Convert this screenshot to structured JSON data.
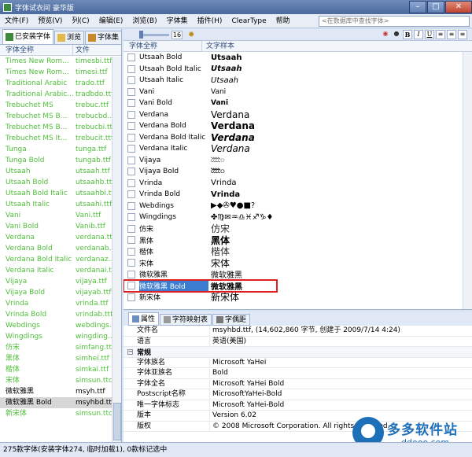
{
  "window": {
    "title": "字体试衣间 豪华版"
  },
  "menu": {
    "items": [
      "文件(F)",
      "预览(V)",
      "列(C)",
      "编辑(E)",
      "浏览(B)",
      "字体集",
      "插件(H)",
      "ClearType",
      "帮助"
    ],
    "search_placeholder": "<在数据库中查找字体>"
  },
  "left_tabs": [
    "已安装字体",
    "浏览",
    "字体集"
  ],
  "left_columns": {
    "name": "字体全称",
    "file": "文件"
  },
  "left_rows": [
    {
      "name": "Times New Rom...",
      "file": "timesbi.ttf",
      "style": "green"
    },
    {
      "name": "Times New Rom...",
      "file": "timesi.ttf",
      "style": "green"
    },
    {
      "name": "Traditional Arabic",
      "file": "trado.ttf",
      "style": "green"
    },
    {
      "name": "Traditional Arabic...",
      "file": "tradbdo.ttf",
      "style": "green"
    },
    {
      "name": "Trebuchet MS",
      "file": "trebuc.ttf",
      "style": "green"
    },
    {
      "name": "Trebuchet MS B...",
      "file": "trebucbd....",
      "style": "green"
    },
    {
      "name": "Trebuchet MS B...",
      "file": "trebucbi.ttf",
      "style": "green"
    },
    {
      "name": "Trebuchet MS It...",
      "file": "trebucit.ttf",
      "style": "green"
    },
    {
      "name": "Tunga",
      "file": "tunga.ttf",
      "style": "green"
    },
    {
      "name": "Tunga Bold",
      "file": "tungab.ttf",
      "style": "green"
    },
    {
      "name": "Utsaah",
      "file": "utsaah.ttf",
      "style": "green"
    },
    {
      "name": "Utsaah Bold",
      "file": "utsaahb.ttf",
      "style": "green"
    },
    {
      "name": "Utsaah Bold Italic",
      "file": "utsaahbi.ttf",
      "style": "green"
    },
    {
      "name": "Utsaah Italic",
      "file": "utsaahi.ttf",
      "style": "green"
    },
    {
      "name": "Vani",
      "file": "Vani.ttf",
      "style": "green"
    },
    {
      "name": "Vani Bold",
      "file": "Vanib.ttf",
      "style": "green"
    },
    {
      "name": "Verdana",
      "file": "verdana.ttf",
      "style": "green"
    },
    {
      "name": "Verdana Bold",
      "file": "verdanab...",
      "style": "green"
    },
    {
      "name": "Verdana Bold Italic",
      "file": "verdanaz...",
      "style": "green"
    },
    {
      "name": "Verdana Italic",
      "file": "verdanai.ttf",
      "style": "green"
    },
    {
      "name": "Vijaya",
      "file": "vijaya.ttf",
      "style": "green"
    },
    {
      "name": "Vijaya Bold",
      "file": "vijayab.ttf",
      "style": "green"
    },
    {
      "name": "Vrinda",
      "file": "vrinda.ttf",
      "style": "green"
    },
    {
      "name": "Vrinda Bold",
      "file": "vrindab.ttf",
      "style": "green"
    },
    {
      "name": "Webdings",
      "file": "webdings...",
      "style": "green"
    },
    {
      "name": "Wingdings",
      "file": "wingding...",
      "style": "green"
    },
    {
      "name": "仿宋",
      "file": "simfang.ttf",
      "style": "green"
    },
    {
      "name": "黑体",
      "file": "simhei.ttf",
      "style": "green"
    },
    {
      "name": "楷体",
      "file": "simkai.ttf",
      "style": "green"
    },
    {
      "name": "宋体",
      "file": "simsun.ttc",
      "style": "green"
    },
    {
      "name": "微软雅黑",
      "file": "msyh.ttf",
      "style": "black"
    },
    {
      "name": "微软雅黑 Bold",
      "file": "msyhbd.ttf",
      "style": "sel"
    },
    {
      "name": "新宋体",
      "file": "simsun.ttc",
      "style": "green"
    }
  ],
  "toolbar": {
    "size": "16",
    "bold": "B",
    "italic": "I",
    "underline": "U"
  },
  "font_columns": {
    "name": "字体全称",
    "sample": "文字样本"
  },
  "font_rows": [
    {
      "name": "Utsaah Bold",
      "sample": "Utsaah",
      "css": "font-weight:bold;font-size:10px"
    },
    {
      "name": "Utsaah Bold Italic",
      "sample": "Utsaah",
      "css": "font-weight:bold;font-style:italic;font-size:10px"
    },
    {
      "name": "Utsaah Italic",
      "sample": "Utsaah",
      "css": "font-style:italic;font-size:10px"
    },
    {
      "name": "Vani",
      "sample": "Vani",
      "css": "font-size:9px"
    },
    {
      "name": "Vani Bold",
      "sample": "Vani",
      "css": "font-weight:bold;font-size:9px"
    },
    {
      "name": "Verdana",
      "sample": "Verdana",
      "css": "font-size:12px"
    },
    {
      "name": "Verdana Bold",
      "sample": "Verdana",
      "css": "font-weight:bold;font-size:12px"
    },
    {
      "name": "Verdana Bold Italic",
      "sample": "Verdana",
      "css": "font-weight:bold;font-style:italic;font-size:12px"
    },
    {
      "name": "Verdana Italic",
      "sample": "Verdana",
      "css": "font-style:italic;font-size:12px"
    },
    {
      "name": "Vijaya",
      "sample": "ৈৈৈৈ",
      "css": "font-size:7px"
    },
    {
      "name": "Vijaya Bold",
      "sample": "ৈৈৈৈ",
      "css": "font-weight:bold;font-size:7px"
    },
    {
      "name": "Vrinda",
      "sample": "Vrinda",
      "css": "font-size:10px"
    },
    {
      "name": "Vrinda Bold",
      "sample": "Vrinda",
      "css": "font-weight:bold;font-size:10px"
    },
    {
      "name": "Webdings",
      "sample": "▶◆✇♥●■?",
      "css": "font-size:10px"
    },
    {
      "name": "Wingdings",
      "sample": "✤♍✉♒♎♓♐♑♦",
      "css": "font-size:10px"
    },
    {
      "name": "仿宋",
      "sample": "仿宋",
      "css": "font-size:12px;color:#333"
    },
    {
      "name": "黑体",
      "sample": "黑体",
      "css": "font-size:12px;font-weight:bold"
    },
    {
      "name": "楷体",
      "sample": "楷体",
      "css": "font-size:12px;color:#333"
    },
    {
      "name": "宋体",
      "sample": "宋体",
      "css": "font-size:12px"
    },
    {
      "name": "微软雅黑",
      "sample": "微软雅黑",
      "css": "font-size:10px"
    },
    {
      "name": "微软雅黑 Bold",
      "sample": "微软雅黑",
      "css": "font-size:10px;font-weight:bold",
      "selected": true
    },
    {
      "name": "新宋体",
      "sample": "新宋体",
      "css": "font-size:12px"
    }
  ],
  "bottom_tabs": [
    "属性",
    "字符映射表",
    "字偶距"
  ],
  "properties": {
    "file_label": "文件名",
    "file_value": "msyhbd.ttf, (14,602,860 字节, 创建于 2009/7/14 4:24)",
    "lang_label": "语言",
    "lang_value": "英语(美国)",
    "section": "常规",
    "rows": [
      {
        "k": "字体族名",
        "v": "Microsoft YaHei"
      },
      {
        "k": "字体亚族名",
        "v": "Bold"
      },
      {
        "k": "字体全名",
        "v": "Microsoft YaHei Bold"
      },
      {
        "k": "Postscript名称",
        "v": "MicrosoftYaHei-Bold"
      },
      {
        "k": "唯一字体标志",
        "v": "Microsoft YaHei-Bold"
      },
      {
        "k": "版本",
        "v": "Version 6.02"
      },
      {
        "k": "版权",
        "v": "© 2008 Microsoft Corporation. All rights reserved."
      }
    ]
  },
  "watermark": {
    "title": "多多软件站",
    "url": "ddooo.com"
  },
  "status": "275款字体(安装字体274, 临时加载1), 0款标记选中"
}
